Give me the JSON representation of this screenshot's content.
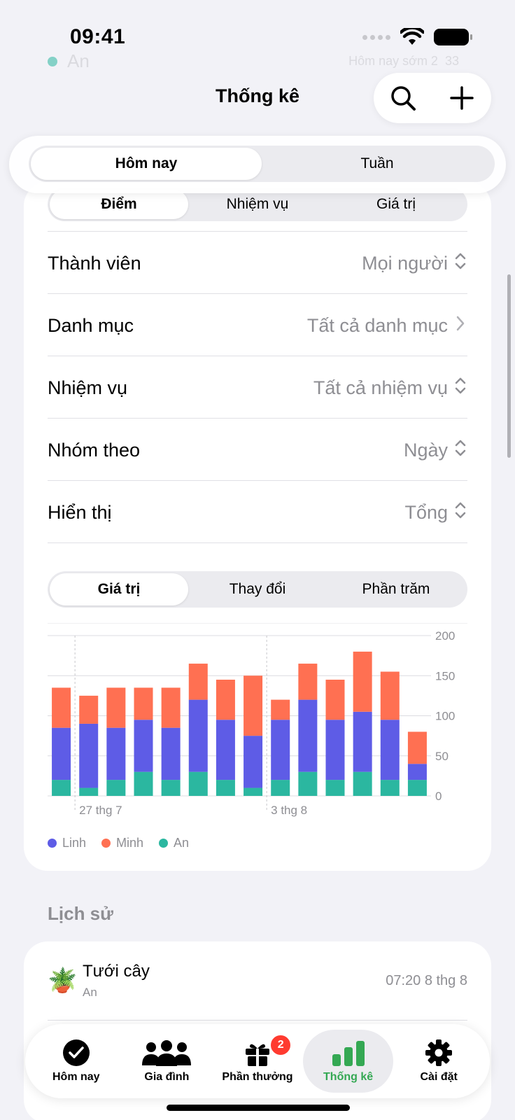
{
  "status_bar": {
    "time": "09:41"
  },
  "header": {
    "title": "Thống kê",
    "search_icon": "search-icon",
    "add_icon": "plus-icon"
  },
  "period_tabs": [
    {
      "label": "Hôm nay",
      "active": true
    },
    {
      "label": "Tuần",
      "active": false
    }
  ],
  "metric_tabs": [
    {
      "label": "Điểm",
      "active": true
    },
    {
      "label": "Nhiệm vụ",
      "active": false
    },
    {
      "label": "Giá trị",
      "active": false
    }
  ],
  "filters": [
    {
      "label": "Thành viên",
      "value": "Mọi người",
      "indicator": "updown"
    },
    {
      "label": "Danh mục",
      "value": "Tất cả danh mục",
      "indicator": "chevron"
    },
    {
      "label": "Nhiệm vụ",
      "value": "Tất cả nhiệm vụ",
      "indicator": "updown"
    },
    {
      "label": "Nhóm theo",
      "value": "Ngày",
      "indicator": "updown"
    },
    {
      "label": "Hiển thị",
      "value": "Tổng",
      "indicator": "updown"
    }
  ],
  "mode_tabs": [
    {
      "label": "Giá trị",
      "active": true
    },
    {
      "label": "Thay đổi",
      "active": false
    },
    {
      "label": "Phần trăm",
      "active": false
    }
  ],
  "chart_data": {
    "type": "bar",
    "stacked": true,
    "categories": [
      "26/7",
      "27/7",
      "28/7",
      "29/7",
      "30/7",
      "31/7",
      "1/8",
      "2/8",
      "3/8",
      "4/8",
      "5/8",
      "6/8",
      "7/8",
      "8/8"
    ],
    "x_tick_labels": [
      {
        "category_index": 1,
        "label": "27 thg 7"
      },
      {
        "category_index": 8,
        "label": "3 thg 8"
      }
    ],
    "series": [
      {
        "name": "An",
        "color": "#2bb7a0",
        "values": [
          20,
          10,
          20,
          30,
          20,
          30,
          20,
          10,
          20,
          30,
          20,
          30,
          20,
          20
        ]
      },
      {
        "name": "Linh",
        "color": "#5e5ce6",
        "values": [
          65,
          80,
          65,
          65,
          65,
          90,
          75,
          65,
          75,
          90,
          75,
          75,
          75,
          20
        ]
      },
      {
        "name": "Minh",
        "color": "#ff7052",
        "values": [
          50,
          35,
          50,
          40,
          50,
          45,
          50,
          75,
          25,
          45,
          50,
          75,
          60,
          40
        ]
      }
    ],
    "ylim": [
      0,
      200
    ],
    "yticks": [
      "0",
      "50",
      "100",
      "150",
      "200"
    ],
    "y_axis_position": "right",
    "grid": true,
    "legend_position": "bottom-left",
    "legend_order": [
      "Linh",
      "Minh",
      "An"
    ]
  },
  "history": {
    "title": "Lịch sử",
    "items": [
      {
        "emoji": "🪴",
        "name": "Tưới cây",
        "member": "An",
        "time": "07:20 8 thg 8"
      }
    ]
  },
  "ghost_rows": [
    {
      "name": "An",
      "note": "Hôm nay sớm 2",
      "points": "33",
      "color": "#2bb7a0"
    }
  ],
  "tab_bar": [
    {
      "label": "Hôm nay",
      "icon": "check-circle-icon",
      "active": false
    },
    {
      "label": "Gia đình",
      "icon": "people-icon",
      "active": false
    },
    {
      "label": "Phần thưởng",
      "icon": "gift-icon",
      "active": false,
      "badge": "2"
    },
    {
      "label": "Thống kê",
      "icon": "bar-chart-icon",
      "active": true
    },
    {
      "label": "Cài đặt",
      "icon": "gear-icon",
      "active": false
    }
  ]
}
